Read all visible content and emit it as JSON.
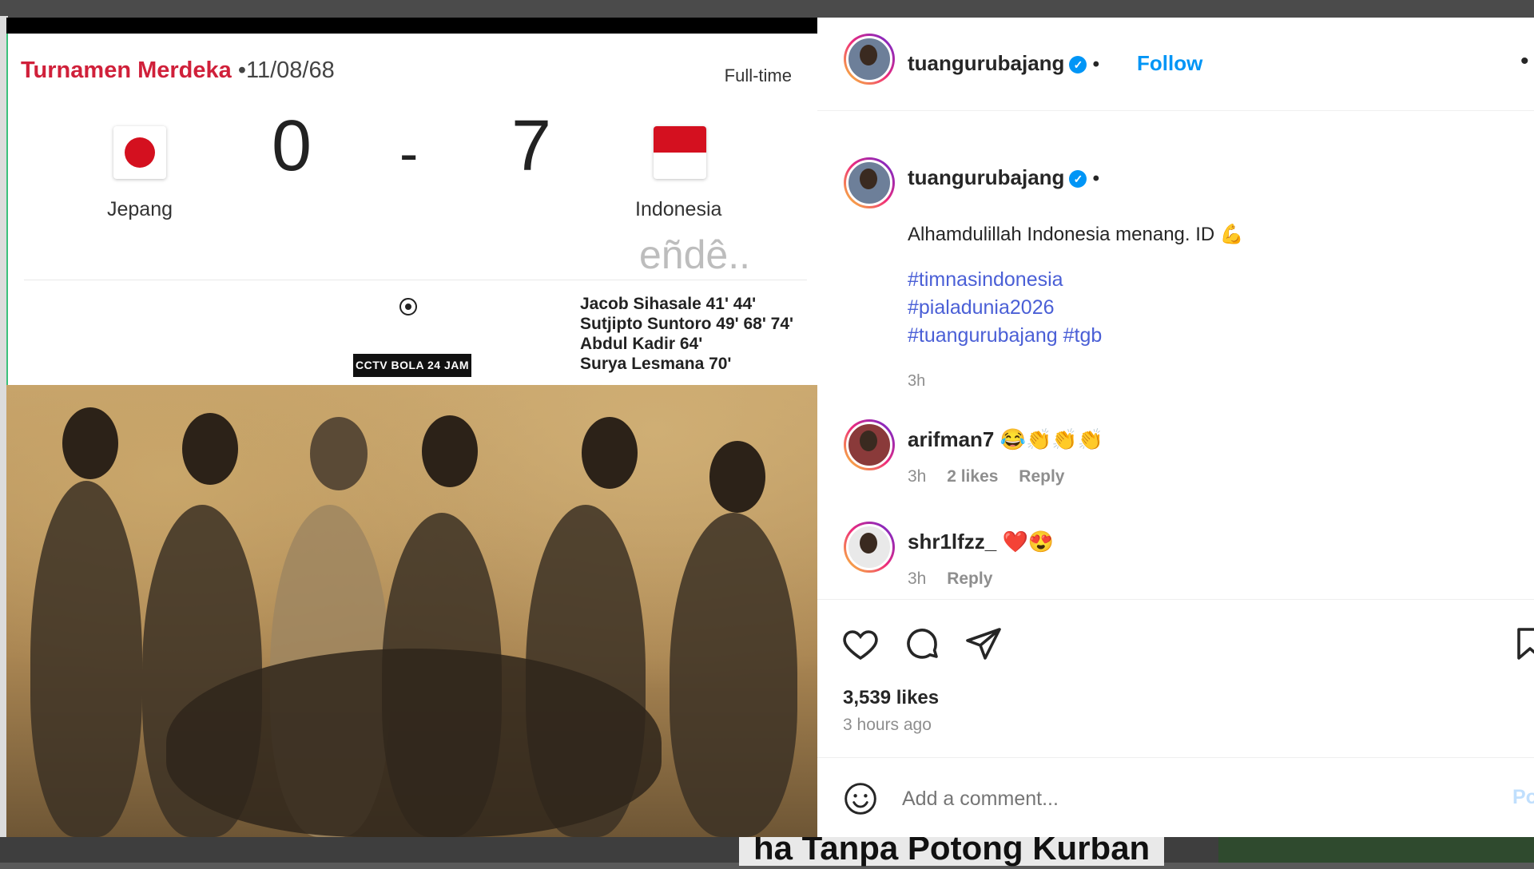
{
  "scoreboard": {
    "tournament": "Turnamen Merdeka",
    "date": "•11/08/68",
    "status": "Full-time",
    "home_team": "Jepang",
    "away_team": "Indonesia",
    "home_score": "0",
    "separator": "-",
    "away_score": "7",
    "watermark": "eñdê..",
    "scorers": [
      "Jacob Sihasale 41' 44'",
      "Sutjipto Suntoro 49' 68' 74'",
      "Abdul Kadir 64'",
      "Surya Lesmana 70'"
    ],
    "photo_badge": "CCTV BOLA 24 JAM"
  },
  "header": {
    "username": "tuangurubajang",
    "separator": "•",
    "follow_label": "Follow",
    "more": "•"
  },
  "caption": {
    "username": "tuangurubajang",
    "text": "Alhamdulillah Indonesia menang. ID 💪",
    "hashtags": [
      "#timnasindonesia",
      "#pialadunia2026",
      "#tuangurubajang #tgb"
    ],
    "time": "3h"
  },
  "comments": [
    {
      "username": "arifman7",
      "text": "😂👏👏👏",
      "time": "3h",
      "likes": "2 likes",
      "reply": "Reply"
    },
    {
      "username": "shr1lfzz_",
      "text": "❤️😍",
      "time": "3h",
      "reply": "Reply"
    }
  ],
  "stats": {
    "likes": "3,539 likes",
    "time": "3 hours ago"
  },
  "comment_box": {
    "placeholder": "Add a comment...",
    "post_label": "Po"
  },
  "background": {
    "headline": "ha Tanpa Potong Kurban"
  }
}
